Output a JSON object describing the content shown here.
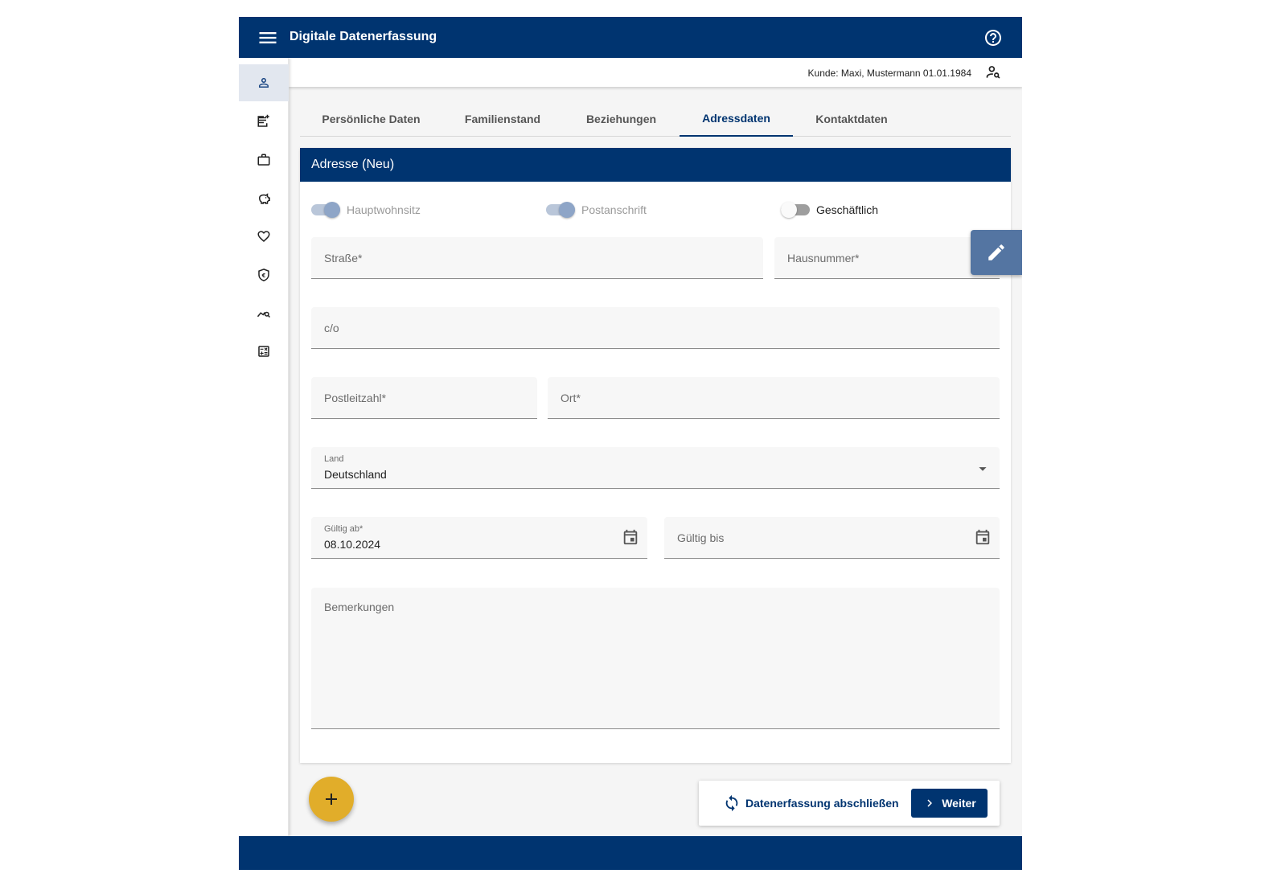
{
  "header": {
    "title": "Digitale Datenerfassung",
    "menu_icon": "menu-icon",
    "help_icon": "help-icon"
  },
  "sidebar": {
    "items": [
      {
        "icon": "person-icon",
        "active": true
      },
      {
        "icon": "note-add-icon",
        "active": false
      },
      {
        "icon": "briefcase-icon",
        "active": false
      },
      {
        "icon": "piggy-bank-icon",
        "active": false
      },
      {
        "icon": "heart-icon",
        "active": false
      },
      {
        "icon": "euro-shield-icon",
        "active": false
      },
      {
        "icon": "chart-search-icon",
        "active": false
      },
      {
        "icon": "calculator-icon",
        "active": false
      }
    ]
  },
  "customer": {
    "text": "Kunde: Maxi, Mustermann 01.01.1984",
    "icon": "person-search-icon"
  },
  "tabs": [
    {
      "label": "Persönliche Daten",
      "active": false
    },
    {
      "label": "Familienstand",
      "active": false
    },
    {
      "label": "Beziehungen",
      "active": false
    },
    {
      "label": "Adressdaten",
      "active": true
    },
    {
      "label": "Kontaktdaten",
      "active": false
    }
  ],
  "card": {
    "title": "Adresse (Neu)",
    "toggles": [
      {
        "label": "Hauptwohnsitz",
        "on": true,
        "disabled": true
      },
      {
        "label": "Postanschrift",
        "on": true,
        "disabled": true
      },
      {
        "label": "Geschäftlich",
        "on": false,
        "disabled": false
      }
    ],
    "fields": {
      "strasse": {
        "placeholder": "Straße*",
        "value": ""
      },
      "hausnummer": {
        "placeholder": "Hausnummer*",
        "value": ""
      },
      "co": {
        "placeholder": "c/o",
        "value": ""
      },
      "plz": {
        "placeholder": "Postleitzahl*",
        "value": ""
      },
      "ort": {
        "placeholder": "Ort*",
        "value": ""
      },
      "land": {
        "label": "Land",
        "value": "Deutschland"
      },
      "gueltig_ab": {
        "label": "Gültig ab*",
        "value": "08.10.2024"
      },
      "gueltig_bis": {
        "placeholder": "Gültig bis",
        "value": ""
      },
      "bemerkungen": {
        "placeholder": "Bemerkungen",
        "value": ""
      }
    }
  },
  "actions": {
    "finish_label": "Datenerfassung abschließen",
    "next_label": "Weiter"
  },
  "colors": {
    "primary": "#003470",
    "accent": "#e1ad2a",
    "edit_fab": "#5475a2"
  }
}
